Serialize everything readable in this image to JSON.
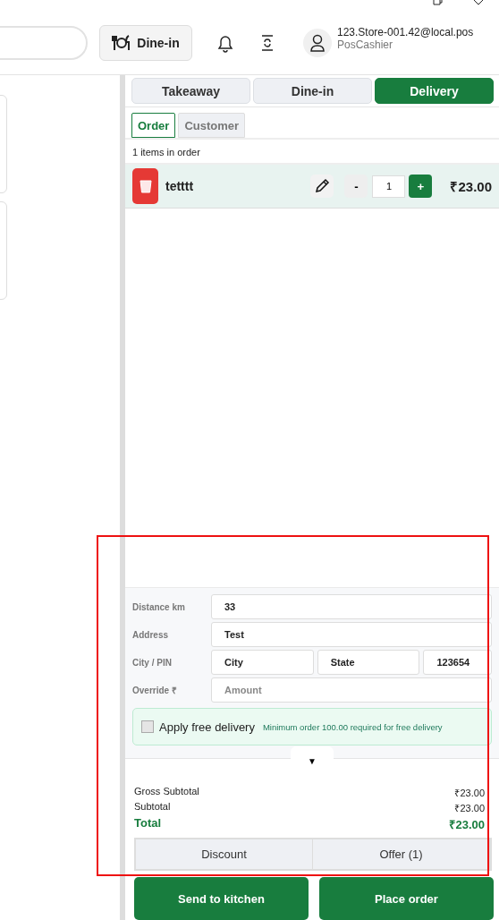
{
  "header": {
    "dine_in_button": "Dine-in",
    "user": {
      "email": "123.Store-001.42@local.pos",
      "role": "PosCashier"
    }
  },
  "order_types": [
    {
      "label": "Takeaway",
      "selected": false
    },
    {
      "label": "Dine-in",
      "selected": false
    },
    {
      "label": "Delivery",
      "selected": true
    }
  ],
  "tabs": [
    {
      "label": "Order",
      "selected": true
    },
    {
      "label": "Customer",
      "selected": false
    }
  ],
  "items_count": "1 items in order",
  "items": [
    {
      "name": "tetttt",
      "quantity": "1",
      "minus": "-",
      "plus": "+",
      "price": "₹23.00"
    }
  ],
  "delivery": {
    "fields": [
      {
        "label": "Distance km",
        "inputs": [
          {
            "value": "33"
          }
        ]
      },
      {
        "label": "Address",
        "inputs": [
          {
            "value": "Test"
          }
        ]
      },
      {
        "label": "City / PIN",
        "inputs": [
          {
            "value": "City"
          },
          {
            "value": "State"
          },
          {
            "value": "123654"
          }
        ]
      },
      {
        "label": "Override ₹",
        "inputs": [
          {
            "placeholder": "Amount"
          }
        ]
      }
    ],
    "free_delivery": {
      "label": "Apply free delivery",
      "checked": false,
      "note": "Minimum order 100.00 required for free delivery"
    },
    "toggle": "▼"
  },
  "totals": [
    {
      "kind": "normal",
      "label": "Gross Subtotal",
      "value": "₹23.00"
    },
    {
      "kind": "normal",
      "label": "Subtotal",
      "value": "₹23.00"
    },
    {
      "kind": "total",
      "label": "Total",
      "value": "₹23.00"
    }
  ],
  "discount_buttons": [
    "Discount",
    "Offer (1)"
  ],
  "actions": [
    "Send to kitchen",
    "Place order"
  ]
}
